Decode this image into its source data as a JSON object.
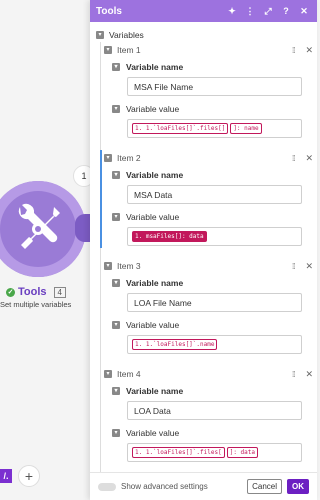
{
  "canvas": {
    "connection_count": "1",
    "module_name": "Tools",
    "module_count": "4",
    "module_subtitle": "Set multiple variables",
    "logo": "/.",
    "add_label": "+"
  },
  "panel": {
    "title": "Tools",
    "header_icons": [
      "sparkle-icon",
      "more-vertical-icon",
      "expand-icon",
      "help-icon",
      "close-icon"
    ],
    "variables_label": "Variables",
    "items": [
      {
        "label": "Item 1",
        "name_label": "Variable name",
        "name_value": "MSA File Name",
        "value_label": "Variable value",
        "pills": [
          {
            "text": "1. 1.`loaFiles[]`.files[]",
            "filled": false
          },
          {
            "text": "]: name",
            "filled": false
          }
        ]
      },
      {
        "label": "Item 2",
        "name_label": "Variable name",
        "name_value": "MSA Data",
        "value_label": "Variable value",
        "pills": [
          {
            "text": "1. msaFiles[]: data",
            "filled": true
          }
        ]
      },
      {
        "label": "Item 3",
        "name_label": "Variable name",
        "name_value": "LOA File Name",
        "value_label": "Variable value",
        "pills": [
          {
            "text": "1. 1.`loaFiles[]`.name",
            "filled": false
          }
        ]
      },
      {
        "label": "Item 4",
        "name_label": "Variable name",
        "name_value": "LOA Data",
        "value_label": "Variable value",
        "pills": [
          {
            "text": "1. 1.`loaFiles[]`.files[",
            "filled": false
          },
          {
            "text": "]: data",
            "filled": false
          }
        ]
      }
    ],
    "footer": {
      "advanced_label": "Show advanced settings",
      "cancel_label": "Cancel",
      "ok_label": "OK"
    }
  },
  "colors": {
    "header": "#9d72df",
    "module": "#9a7bd6",
    "pill": "#c2185b",
    "ok_button": "#6c1fc2"
  }
}
